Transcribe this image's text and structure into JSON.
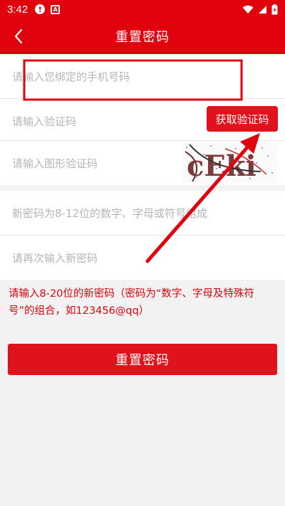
{
  "status": {
    "time": "3:42",
    "notif1": "!",
    "notif2": "A"
  },
  "header": {
    "title": "重置密码"
  },
  "form": {
    "phone_placeholder": "请输入您绑定的手机号码",
    "sms_placeholder": "请输入验证码",
    "sms_button": "获取验证码",
    "captcha_placeholder": "请输入图形验证码",
    "captcha_text": "cEki",
    "new_password_placeholder": "新密码为8-12位的数字、字母或符号组成",
    "confirm_password_placeholder": "请再次输入新密码"
  },
  "hint": {
    "text": "请输入8-20位的新密码（密码为“数字、字母及特殊符号”的组合，如123456@qq）"
  },
  "actions": {
    "reset_button": "重置密码"
  },
  "colors": {
    "brand_red": "#e0020c",
    "placeholder": "#b5b5b5"
  }
}
